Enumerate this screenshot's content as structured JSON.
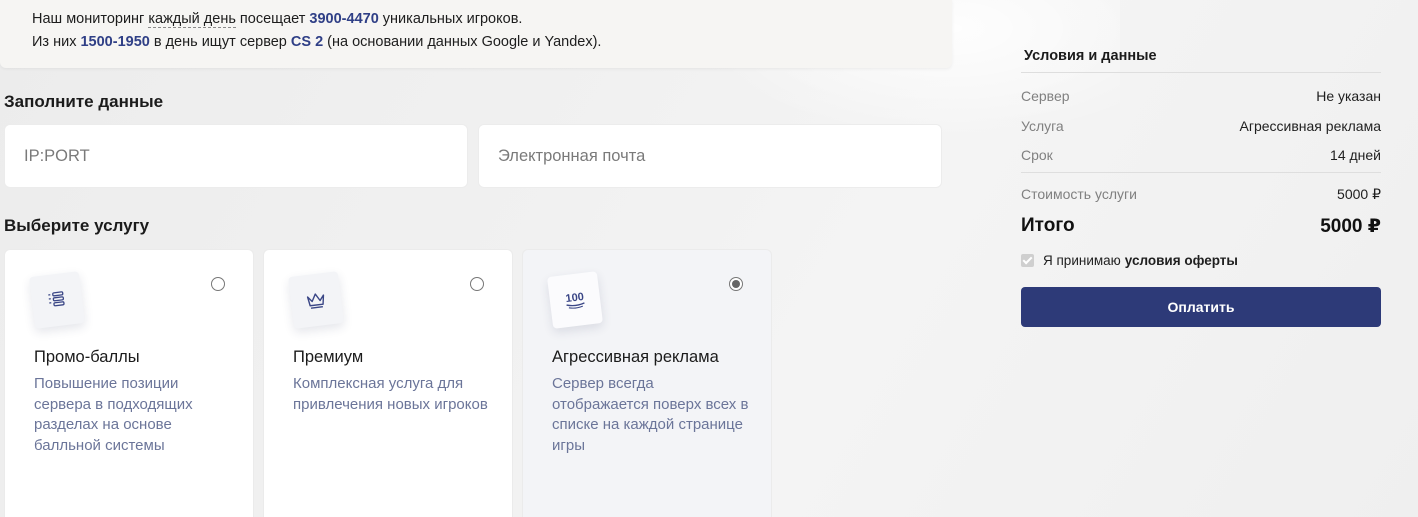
{
  "info": {
    "line1_pre": "Наш мониторинг ",
    "line1_dotted": "каждый день",
    "line1_mid": " посещает ",
    "line1_visitors": "3900-4470",
    "line1_post": " уникальных игроков.",
    "line2_pre": "Из них ",
    "line2_searches": "1500-1950",
    "line2_mid": " в день ищут сервер ",
    "line2_game": "CS 2",
    "line2_post": " (на основании данных Google и Yandex)."
  },
  "form": {
    "title": "Заполните данные",
    "ip_placeholder": "IP:PORT",
    "email_placeholder": "Электронная почта"
  },
  "services": {
    "title": "Выберите услугу",
    "items": [
      {
        "title": "Промо-баллы",
        "description": "Повышение позиции сервера в подходящих разделах на основе балльной системы",
        "icon": "list-stack-icon",
        "selected": false
      },
      {
        "title": "Премиум",
        "description": "Комплексная услуга для привлечения новых игроков",
        "icon": "crown-icon",
        "selected": false
      },
      {
        "title": "Агрессивная реклама",
        "description": "Сервер всегда отображается поверх всех в списке на каждой странице игры",
        "icon": "hundred-icon",
        "icon_text": "100",
        "selected": true
      }
    ]
  },
  "summary": {
    "title": "Условия и данные",
    "rows": [
      {
        "key": "Сервер",
        "value": "Не указан"
      },
      {
        "key": "Услуга",
        "value": "Агрессивная реклама"
      },
      {
        "key": "Срок",
        "value": "14 дней"
      }
    ],
    "cost_label": "Стоимость услуги",
    "cost_value": "5000 ₽",
    "total_label": "Итого",
    "total_value": "5000 ₽",
    "accept_text": "Я принимаю",
    "accept_link": "условия оферты",
    "accepted": true,
    "pay_label": "Оплатить"
  },
  "colors": {
    "accent": "#2d3a78",
    "highlight": "#2f3f86",
    "muted_text": "#6b7599"
  }
}
